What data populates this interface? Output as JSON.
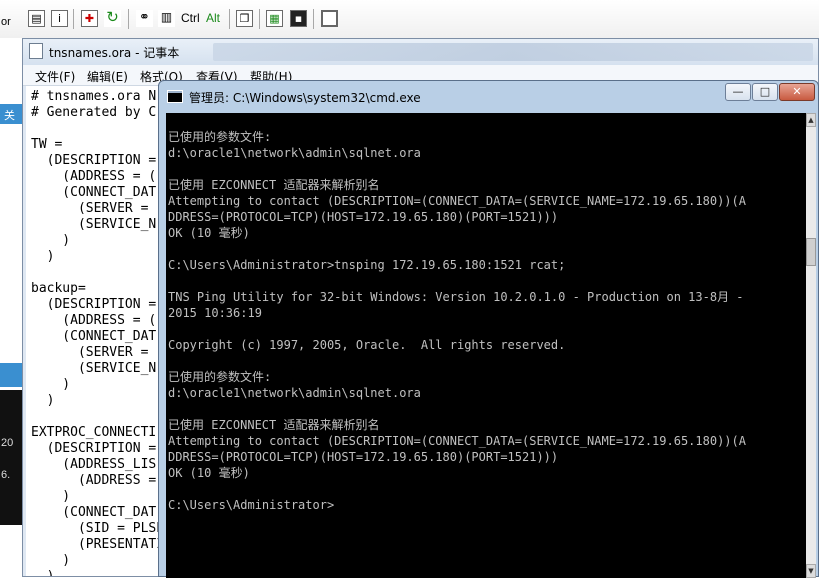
{
  "toolbar": {
    "icons": [
      "page-icon",
      "info-icon",
      "crosshair-icon",
      "refresh-icon",
      "link-icon",
      "format-icon"
    ],
    "ctrl_label": "Ctrl",
    "alt_label": "Alt",
    "icons_right": [
      "copy-icon",
      "paste-icon",
      "save-icon",
      "window-icon"
    ]
  },
  "background_window": {
    "labels": [
      "or",
      "关",
      "20",
      "6."
    ]
  },
  "notepad": {
    "title": "tnsnames.ora - 记事本",
    "menu": [
      "文件(F)",
      "编辑(E)",
      "格式(O)",
      "查看(V)",
      "帮助(H)"
    ],
    "lines": [
      "# tnsnames.ora N",
      "# Generated by C",
      "",
      "TW =",
      "  (DESCRIPTION =",
      "    (ADDRESS = (",
      "    (CONNECT_DAT",
      "      (SERVER =",
      "      (SERVICE_N",
      "    )",
      "  )",
      "",
      "backup=",
      "  (DESCRIPTION =",
      "    (ADDRESS = (",
      "    (CONNECT_DAT",
      "      (SERVER =",
      "      (SERVICE_N",
      "    )",
      "  )",
      "",
      "EXTPROC_CONNECTI",
      "  (DESCRIPTION =",
      "    (ADDRESS_LIS",
      "      (ADDRESS =",
      "    )",
      "    (CONNECT_DAT",
      "      (SID = PLSExtProc)",
      "      (PRESENTATION = RO)",
      "    )",
      "  )"
    ]
  },
  "cmd": {
    "title": "管理员: C:\\Windows\\system32\\cmd.exe",
    "controls": {
      "minimize": "—",
      "maximize": "□",
      "close": "✕"
    },
    "lines": [
      "",
      "已使用的参数文件:",
      "d:\\oracle1\\network\\admin\\sqlnet.ora",
      "",
      "已使用 EZCONNECT 适配器来解析别名",
      "Attempting to contact (DESCRIPTION=(CONNECT_DATA=(SERVICE_NAME=172.19.65.180))(A",
      "DDRESS=(PROTOCOL=TCP)(HOST=172.19.65.180)(PORT=1521)))",
      "OK (10 毫秒)",
      "",
      "C:\\Users\\Administrator>tnsping 172.19.65.180:1521 rcat;",
      "",
      "TNS Ping Utility for 32-bit Windows: Version 10.2.0.1.0 - Production on 13-8月 -",
      "2015 10:36:19",
      "",
      "Copyright (c) 1997, 2005, Oracle.  All rights reserved.",
      "",
      "已使用的参数文件:",
      "d:\\oracle1\\network\\admin\\sqlnet.ora",
      "",
      "已使用 EZCONNECT 适配器来解析别名",
      "Attempting to contact (DESCRIPTION=(CONNECT_DATA=(SERVICE_NAME=172.19.65.180))(A",
      "DDRESS=(PROTOCOL=TCP)(HOST=172.19.65.180)(PORT=1521)))",
      "OK (10 毫秒)",
      "",
      "C:\\Users\\Administrator>"
    ]
  },
  "colors": {
    "console_bg": "#000000",
    "console_fg": "#c0c0c0",
    "titlebar": "#b9cfe6"
  }
}
